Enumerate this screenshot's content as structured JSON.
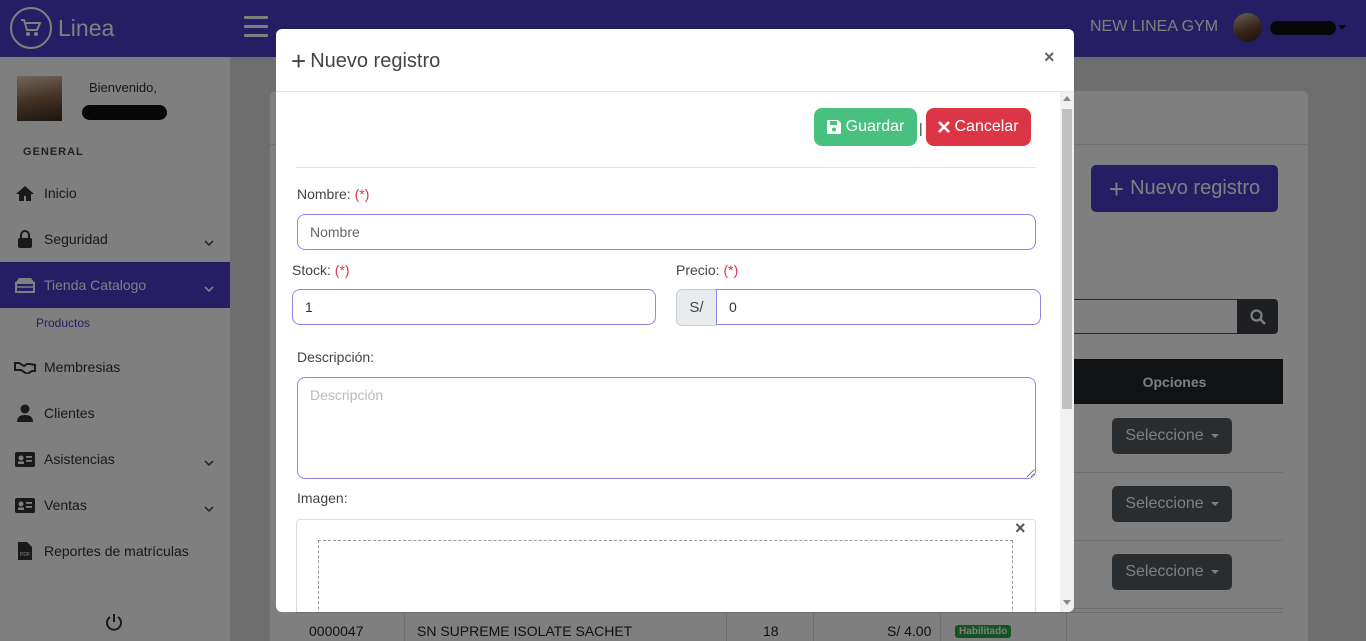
{
  "topbar": {
    "brand_name": "Linea",
    "gym_name": "NEW LINEA GYM"
  },
  "sidebar": {
    "welcome": "Bienvenido,",
    "section_label": "GENERAL",
    "items": [
      {
        "label": "Inicio",
        "icon": "home-icon",
        "has_chevron": false
      },
      {
        "label": "Seguridad",
        "icon": "lock-icon",
        "has_chevron": true
      },
      {
        "label": "Tienda Catalogo",
        "icon": "store-icon",
        "has_chevron": true,
        "active": true
      },
      {
        "label": "Membresias",
        "icon": "handshake-icon",
        "has_chevron": false
      },
      {
        "label": "Clientes",
        "icon": "user-icon",
        "has_chevron": false
      },
      {
        "label": "Asistencias",
        "icon": "id-card-icon",
        "has_chevron": true
      },
      {
        "label": "Ventas",
        "icon": "id-card-icon",
        "has_chevron": true
      },
      {
        "label": "Reportes de matrículas",
        "icon": "pdf-file-icon",
        "has_chevron": false
      }
    ],
    "sub_item": "Productos"
  },
  "background": {
    "new_button": "Nuevo registro",
    "table_header_options": "Opciones",
    "select_label": "Seleccione",
    "bottom_row": {
      "code": "0000047",
      "name": "SN SUPREME ISOLATE SACHET",
      "stock": "18",
      "price": "S/ 4.00",
      "status": "Habilitado"
    }
  },
  "modal": {
    "title": "Nuevo registro",
    "save_label": "Guardar",
    "cancel_label": "Cancelar",
    "separator": "|",
    "required_mark": "(*)",
    "nombre": {
      "label": "Nombre:",
      "placeholder": "Nombre",
      "value": ""
    },
    "stock": {
      "label": "Stock:",
      "value": "1"
    },
    "precio": {
      "label": "Precio:",
      "prefix": "S/",
      "value": "0"
    },
    "descripcion": {
      "label": "Descripción:",
      "placeholder": "Descripción"
    },
    "imagen": {
      "label": "Imagen:"
    }
  },
  "colors": {
    "primary": "#4a3cc8",
    "success": "#48c07f",
    "danger": "#dc3545",
    "dark": "#212529"
  }
}
